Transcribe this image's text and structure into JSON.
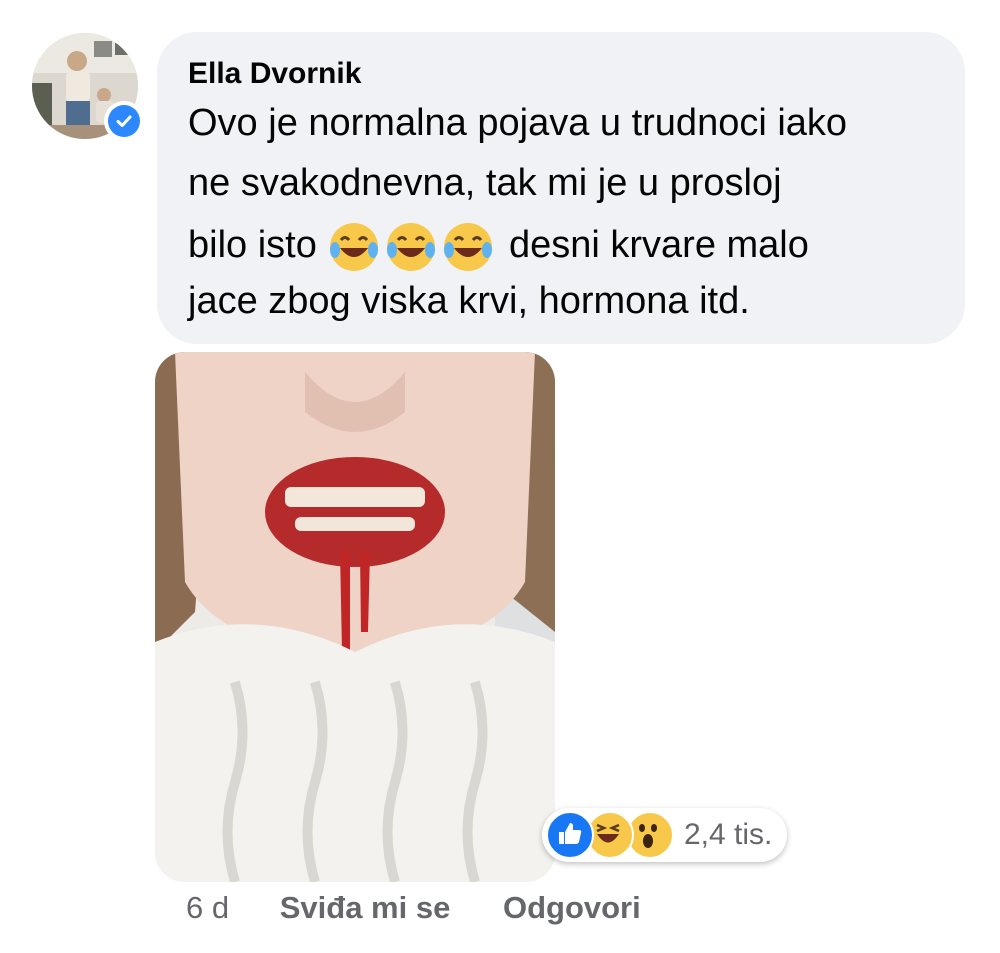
{
  "comment": {
    "author": "Ella Dvornik",
    "verified": true,
    "text_lines": [
      "Ovo je normalna pojava u trudnoci iako",
      "ne svakodnevna, tak mi je u prosloj",
      "bilo  isto",
      "desni krvare malo",
      "jace zbog viska krvi, hormona itd."
    ],
    "inline_emojis": [
      "laughing-with-tears-emoji",
      "laughing-with-tears-emoji",
      "laughing-with-tears-emoji"
    ]
  },
  "reactions": {
    "icons": [
      "like-reaction-icon",
      "haha-reaction-icon",
      "wow-reaction-icon"
    ],
    "count": "2,4 tis."
  },
  "footer": {
    "timestamp": "6 d",
    "like_label": "Sviđa mi se",
    "reply_label": "Odgovori"
  },
  "colors": {
    "bubble_bg": "#f0f2f5",
    "verified_blue": "#2d88ff",
    "meta_gray": "#65676b",
    "like_blue": "#1877f2",
    "emoji_yellow": "#f7c84a"
  }
}
